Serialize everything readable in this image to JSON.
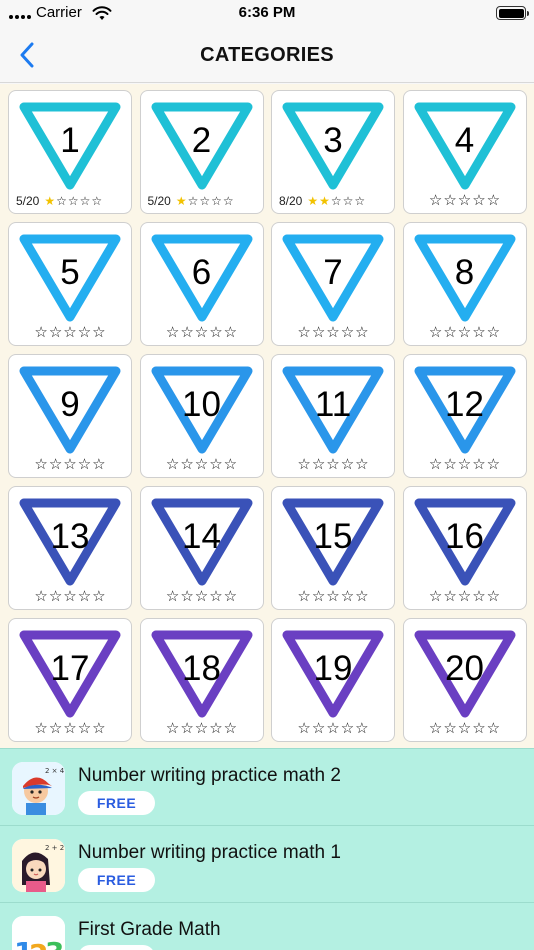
{
  "status": {
    "carrier": "Carrier",
    "time": "6:36 PM"
  },
  "nav": {
    "title": "CATEGORIES",
    "back_icon": "chevron-left-icon"
  },
  "colors": {
    "nav_accent": "#1d7bf0",
    "grid_background": "#fbf6e8",
    "app_row_background": "#b4f0e2",
    "free_text": "#2a5ce0",
    "star_filled": "#f2c200"
  },
  "categories": [
    {
      "number": "1",
      "score": "5/20",
      "stars_filled": 1,
      "color": "#1fc0d6"
    },
    {
      "number": "2",
      "score": "5/20",
      "stars_filled": 1,
      "color": "#1fc0d6"
    },
    {
      "number": "3",
      "score": "8/20",
      "stars_filled": 2,
      "color": "#1fc0d6"
    },
    {
      "number": "4",
      "score": "",
      "stars_filled": 0,
      "color": "#1fc0d6"
    },
    {
      "number": "5",
      "score": "",
      "stars_filled": 0,
      "color": "#24aef0"
    },
    {
      "number": "6",
      "score": "",
      "stars_filled": 0,
      "color": "#24aef0"
    },
    {
      "number": "7",
      "score": "",
      "stars_filled": 0,
      "color": "#24aef0"
    },
    {
      "number": "8",
      "score": "",
      "stars_filled": 0,
      "color": "#24aef0"
    },
    {
      "number": "9",
      "score": "",
      "stars_filled": 0,
      "color": "#2a96ea"
    },
    {
      "number": "10",
      "score": "",
      "stars_filled": 0,
      "color": "#2a96ea"
    },
    {
      "number": "11",
      "score": "",
      "stars_filled": 0,
      "color": "#2a96ea"
    },
    {
      "number": "12",
      "score": "",
      "stars_filled": 0,
      "color": "#2a96ea"
    },
    {
      "number": "13",
      "score": "",
      "stars_filled": 0,
      "color": "#3a52b8"
    },
    {
      "number": "14",
      "score": "",
      "stars_filled": 0,
      "color": "#3a52b8"
    },
    {
      "number": "15",
      "score": "",
      "stars_filled": 0,
      "color": "#3a52b8"
    },
    {
      "number": "16",
      "score": "",
      "stars_filled": 0,
      "color": "#3a52b8"
    },
    {
      "number": "17",
      "score": "",
      "stars_filled": 0,
      "color": "#6a3fc2"
    },
    {
      "number": "18",
      "score": "",
      "stars_filled": 0,
      "color": "#6a3fc2"
    },
    {
      "number": "19",
      "score": "",
      "stars_filled": 0,
      "color": "#6a3fc2"
    },
    {
      "number": "20",
      "score": "",
      "stars_filled": 0,
      "color": "#6a3fc2"
    }
  ],
  "apps": [
    {
      "name": "Number writing practice math 2",
      "button": "FREE",
      "icon": "boy-math-app-icon",
      "icon_label": "2 × 4"
    },
    {
      "name": "Number writing practice math 1",
      "button": "FREE",
      "icon": "girl-math-app-icon",
      "icon_label": "2 + 2"
    },
    {
      "name": "First Grade Math",
      "button": "FREE",
      "icon": "123-math-app-icon",
      "icon_label": "123"
    }
  ]
}
